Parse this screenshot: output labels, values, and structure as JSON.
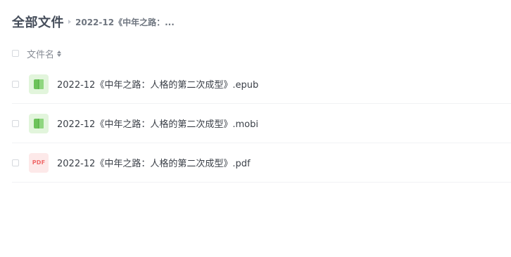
{
  "breadcrumb": {
    "root": "全部文件",
    "current": "2022-12《中年之路：..."
  },
  "list_header": {
    "column_name": "文件名"
  },
  "files": [
    {
      "name": "2022-12《中年之路：人格的第二次成型》.epub",
      "icon": "ebook-icon",
      "icon_color": "#6cc35a"
    },
    {
      "name": "2022-12《中年之路：人格的第二次成型》.mobi",
      "icon": "ebook-icon",
      "icon_color": "#6cc35a"
    },
    {
      "name": "2022-12《中年之路：人格的第二次成型》.pdf",
      "icon": "pdf-icon",
      "icon_label": "PDF",
      "icon_color": "#f06a6a"
    }
  ]
}
